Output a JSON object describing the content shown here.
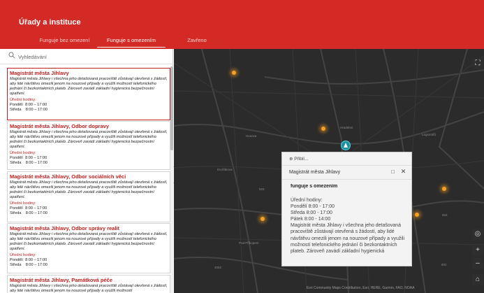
{
  "header": {
    "title": "Úřady a instituce",
    "tabs": [
      {
        "label": "Funguje bez omezení",
        "active": false
      },
      {
        "label": "Funguje s omezením",
        "active": true
      },
      {
        "label": "Zavřeno",
        "active": false
      }
    ],
    "color": "#d42a26"
  },
  "search": {
    "placeholder": "Vyhledávání"
  },
  "cards": [
    {
      "title": "Magistrát města Jihlavy",
      "description": "Magistrát města Jihlavy i všechna jeho detašovaná pracoviště zůstávají otevřená s žádostí, aby lidé návštěvu omezili jenom na nouzové případy a využili možností telefonického jednání či bezkontaktních plateb. Zároveň zavádí základní hygienická bezpečnostní opatření.",
      "hours_label": "Úřední hodiny:",
      "hours": [
        "Pondělí  8:00 – 17:00",
        "Středa    8:00 – 17:00"
      ],
      "selected": true
    },
    {
      "title": "Magistrát města Jihlavy, Odbor dopravy",
      "description": "Magistrát města Jihlavy i všechna jeho detašovaná pracoviště zůstávají otevřená s žádostí, aby lidé návštěvu omezili jenom na nouzové případy a využili možností telefonického jednání či bezkontaktních plateb. Zároveň zavádí základní hygienická bezpečnostní opatření.",
      "hours_label": "Úřední hodiny:",
      "hours": [
        "Pondělí  8:00 – 17:00",
        "Středa    8:00 – 17:00"
      ],
      "selected": false
    },
    {
      "title": "Magistrát města Jihlavy, Odbor sociálních věcí",
      "description": "Magistrát města Jihlavy i všechna jeho detašovaná pracoviště zůstávají otevřená s žádostí, aby lidé návštěvu omezili jenom na nouzové případy a využili možností telefonického jednání či bezkontaktních plateb. Zároveň zavádí základní hygienická bezpečnostní opatření.",
      "hours_label": "Úřední hodiny:",
      "hours": [
        "Pondělí  8:00 – 17:00",
        "Středa    8:00 – 17:00"
      ],
      "selected": false
    },
    {
      "title": "Magistrát města Jihlavy, Odbor správy realit",
      "description": "Magistrát města Jihlavy i všechna jeho detašovaná pracoviště zůstávají otevřená s žádostí, aby lidé návštěvu omezili jenom na nouzové případy a využili možností telefonického jednání či bezkontaktních plateb. Zároveň zavádí základní hygienická bezpečnostní opatření.",
      "hours_label": "Úřední hodiny:",
      "hours": [
        "Pondělí  8:00 – 17:00",
        "Středa    8:00 – 17:00"
      ],
      "selected": false
    },
    {
      "title": "Magistrát města Jihlavy, Památková péče",
      "description": "Magistrát města Jihlavy i všechna jeho detašovaná pracoviště zůstávají otevřená s žádostí, aby lidé návštěvu omezili jenom na nouzové případy a využili možností",
      "hours_label": "",
      "hours": [],
      "selected": false
    }
  ],
  "popup": {
    "zoom_label": "Přiblí...",
    "title": "Magistrát města Jihlavy",
    "status": "funguje s omezením",
    "lines": [
      "Úřední hodiny:",
      "Pondělí 8:00 - 17:00",
      "Středa 8:00 - 17:00",
      "Pátek 8:00 - 14:00",
      "Magistrát města Jihlavy i všechna jeho detašovaná pracoviště zůstávají otevřená s žádostí, aby lidé návštěvu omezili jenom na nouzové případy a využili možností telefonického jednání či bezkontaktních plateb. Zároveň zavádí základní hygienická"
    ]
  },
  "map": {
    "background": "#2b2b2b",
    "marker_color": "#f6a123",
    "selected_marker_color": "#1f8f9d",
    "streets": [
      "Hradební",
      "Pod Příkopem",
      "Dvořákova",
      "Husova",
      "Legionářů"
    ],
    "road_numbers": [
      "523",
      "602",
      "602",
      "4062"
    ],
    "attribution": "Esri Community Maps Contributors, Esri, HERE, Garmin, FAO, NOAA"
  },
  "controls": {
    "expand_icon": "expand-icon",
    "locate_icon": "locate-icon",
    "zoom_in": "+",
    "zoom_out": "–",
    "home_icon": "home-icon"
  }
}
